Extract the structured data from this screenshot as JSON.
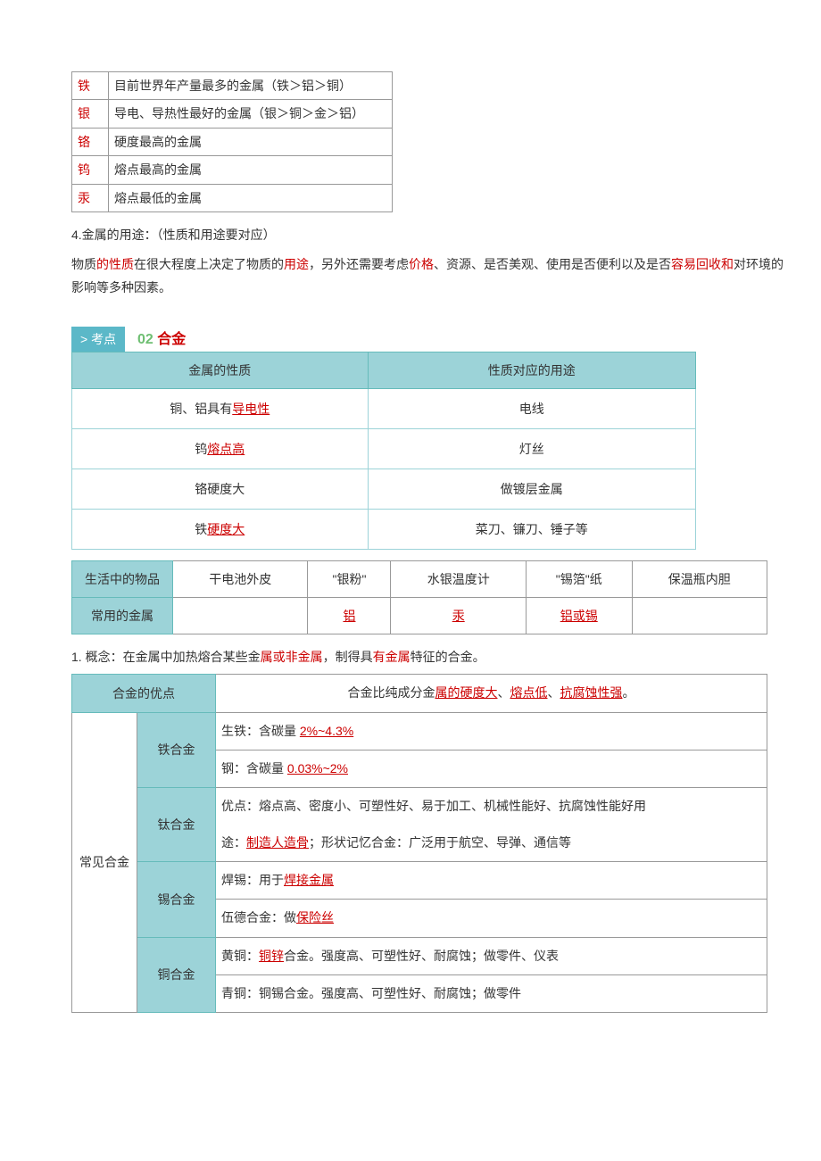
{
  "table1": {
    "rows": [
      {
        "label": "铁",
        "desc": "目前世界年产量最多的金属（铁＞铝＞铜）"
      },
      {
        "label": "银",
        "desc": "导电、导热性最好的金属（银＞铜＞金＞铝）"
      },
      {
        "label": "铬",
        "desc": "硬度最高的金属"
      },
      {
        "label": "钨",
        "desc": "熔点最高的金属"
      },
      {
        "label": "汞",
        "desc": "熔点最低的金属"
      }
    ]
  },
  "para": {
    "heading4": "4.金属的用途：（性质和用途要对应）",
    "seg1": "物质",
    "seg2": "的性质",
    "seg3": "在很大程度上决定了物质的",
    "seg4": "用途",
    "seg5": "，另外还需要考虑",
    "seg6": "价格",
    "seg7": "、资源、是否美观、使用是否便利以及是否",
    "seg8": "容易回收和",
    "seg9": "对环境的影响等多种因素。"
  },
  "section": {
    "tag": "> 考点",
    "num": "02",
    "title": "合金"
  },
  "table2": {
    "h1": "金属的性质",
    "h2": "性质对应的用途",
    "rows": [
      {
        "c1a": "铜、铝具有",
        "c1b": "导电性",
        "c2": "电线"
      },
      {
        "c1a": "钨",
        "c1b": "熔点高",
        "c2": "灯丝"
      },
      {
        "c1a": "铬硬度大",
        "c1b": "",
        "c2": "做镀层金属"
      },
      {
        "c1a": "铁",
        "c1b": "硬度大",
        "c2": "菜刀、镰刀、锤子等"
      }
    ]
  },
  "table3": {
    "r1label": "生活中的物品",
    "r1": [
      "干电池外皮",
      "\"银粉\"",
      "水银温度计",
      "\"锡箔\"纸",
      "保温瓶内胆"
    ],
    "r2label": "常用的金属",
    "r2": [
      "",
      "铝",
      "汞",
      "铝或锡",
      ""
    ]
  },
  "concept": {
    "pre": "1. 概念：在金属中加热熔合某些金",
    "red1": "属或非金属",
    "mid": "，制得具",
    "red2": "有金属",
    "post": "特征的合金。"
  },
  "table4": {
    "h1": "合金的优点",
    "h2pre": "合金比纯成分金",
    "h2r1": "属的硬度大",
    "h2sep1": "、",
    "h2r2": "熔点低",
    "h2sep2": "、",
    "h2r3": "抗腐蚀性强",
    "h2post": "。",
    "sideLabel": "常见合金",
    "rows": {
      "iron": {
        "name": "铁合金",
        "l1a": "生铁：含碳量 ",
        "l1b": "2%~4.3%",
        "l2a": "钢：含碳量 ",
        "l2b": "0.03%~2%"
      },
      "ti": {
        "name": "钛合金",
        "l1": "优点：熔点高、密度小、可塑性好、易于加工、机械性能好、抗腐蚀性能好用",
        "l2a": "途：",
        "l2b": "制造人造骨",
        "l2c": "；形状记忆合金：广泛用于航空、导弹、通信等"
      },
      "tin": {
        "name": "锡合金",
        "l1a": "焊锡：用于",
        "l1b": "焊接金属",
        "l2a": "伍德合金：做",
        "l2b": "保险丝"
      },
      "cu": {
        "name": "铜合金",
        "l1a": "黄铜：",
        "l1b": "铜锌",
        "l1c": "合金。强度高、可塑性好、耐腐蚀；做零件、仪表",
        "l2": "青铜：铜锡合金。强度高、可塑性好、耐腐蚀；做零件"
      }
    }
  }
}
